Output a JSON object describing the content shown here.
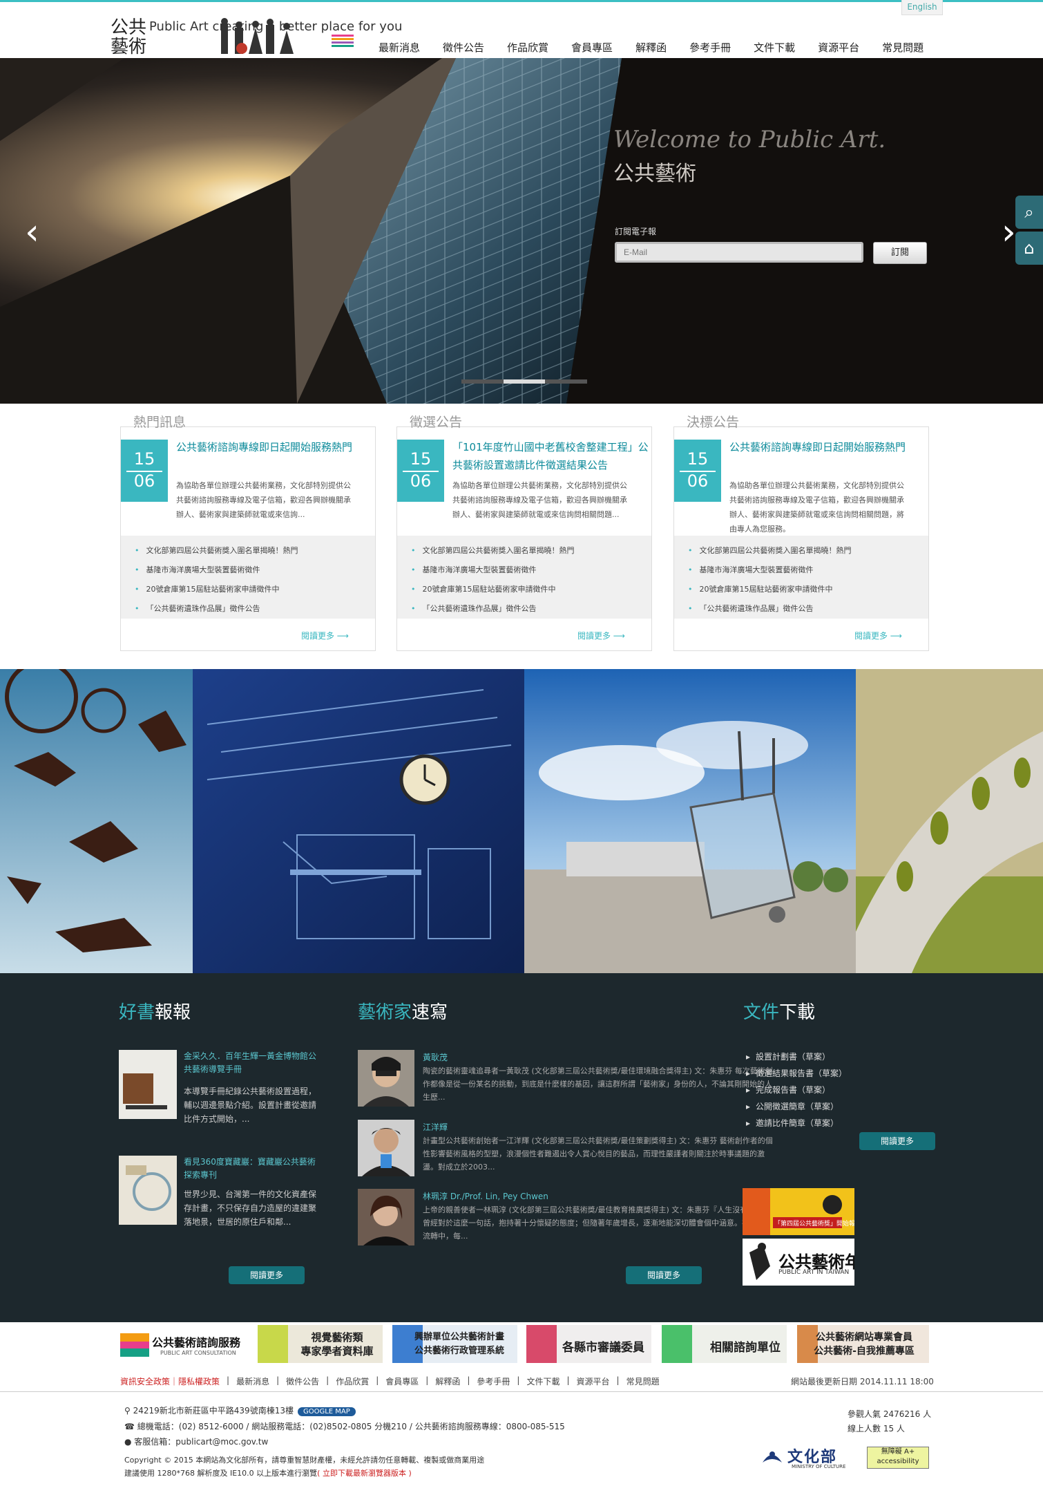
{
  "header": {
    "english": "English",
    "logo_cjk": "公共藝術",
    "logo_en": "Public Art creating a better place for you",
    "nav": [
      "最新消息",
      "徵件公告",
      "作品欣賞",
      "會員專區",
      "解釋函",
      "參考手冊",
      "文件下載",
      "資源平台",
      "常見問題"
    ]
  },
  "hero": {
    "welcome": "Welcome to Public Art.",
    "subtitle": "公共藝術",
    "subscribe_label": "訂閱電子報",
    "email_placeholder": "E-Mail",
    "subscribe_button": "訂閱"
  },
  "cards": [
    {
      "title": "熱門訊息",
      "date_day": "15",
      "date_month": "06",
      "headline": "公共藝術諮詢專線即日起開始服務熱門",
      "body": "為協助各單位辦理公共藝術業務，文化部特別提供公共藝術諮詢服務專線及電子信箱，歡迎各興辦機關承辦人、藝術家與建築師就電或來信詢...",
      "items": [
        "文化部第四屆公共藝術獎入圍名單揭曉！熱門",
        "基隆市海洋廣場大型裝置藝術徵件",
        "20號倉庫第15屆駐站藝術家申請徵件中",
        "「公共藝術遺珠作品展」徵件公告"
      ],
      "more": "閱讀更多 ⟶"
    },
    {
      "title": "徵選公告",
      "date_day": "15",
      "date_month": "06",
      "headline": "「101年度竹山國中老舊校舍整建工程」公共藝術設置邀請比件徵選結果公告",
      "body": "為協助各單位辦理公共藝術業務，文化部特別提供公共藝術諮詢服務專線及電子信箱，歡迎各興辦機關承辦人、藝術家與建築師就電或來信詢問相關問題...",
      "items": [
        "文化部第四屆公共藝術獎入圍名單揭曉！熱門",
        "基隆市海洋廣場大型裝置藝術徵件",
        "20號倉庫第15屆駐站藝術家申請徵件中",
        "「公共藝術遺珠作品展」徵件公告"
      ],
      "more": "閱讀更多 ⟶"
    },
    {
      "title": "決標公告",
      "date_day": "15",
      "date_month": "06",
      "headline": "公共藝術諮詢專線即日起開始服務熱門",
      "body": "為協助各單位辦理公共藝術業務，文化部特別提供公共藝術諮詢服務專線及電子信箱，歡迎各興辦機關承辦人、藝術家與建築師就電或來信詢問相關問題，將由專人為您服務。",
      "items": [
        "文化部第四屆公共藝術獎入圍名單揭曉！熱門",
        "基隆市海洋廣場大型裝置藝術徵件",
        "20號倉庫第15屆駐站藝術家申請徵件中",
        "「公共藝術遺珠作品展」徵件公告"
      ],
      "more": "閱讀更多 ⟶"
    }
  ],
  "books": {
    "title_a": "好書",
    "title_b": "報報",
    "items": [
      {
        "title": "金采久久．百年生輝一黃金博物館公共藝術導覽手冊",
        "body": "本導覽手冊紀錄公共藝術設置過程，輔以週邊景點介紹。設置計畫從邀請比件方式開始，..."
      },
      {
        "title": "看見360度寶藏巖：寶藏巖公共藝術探索專刊",
        "body": "世界少見、台灣第一件的文化資產保存計畫，不只保存自力造屋的違建聚落地景，世居的原住戶和鄰..."
      }
    ],
    "more": "閱讀更多"
  },
  "artists": {
    "title_a": "藝術家",
    "title_b": "速寫",
    "items": [
      {
        "name": "黃耿茂",
        "body": "陶瓷的藝術靈魂追尋者一黃耿茂 (文化部第三屆公共藝術獎/最佳環境融合獎得主) 文：朱惠芬 每次藝術創作都像是從一份某名的挑動，到底是什麼樣的基因，讓這群所謂「藝術家」身份的人，不論其剛開始的人生歷..."
      },
      {
        "name": "江洋輝",
        "body": "計畫型公共藝術創始者一江洋輝 (文化部第三屆公共藝術獎/最佳策劃獎得主) 文：朱惠芬 藝術創作者的個性影響藝術風格的型塑，浪漫個性者難遏出令人賞心悅目的藝品，而理性嚴謹者則關注於時事議題的激盪。對成立於2003..."
      },
      {
        "name": "林珮淳 Dr./Prof. Lin, Pey Chwen",
        "body": "上帝的親善使者一林珮淳 (文化部第三屆公共藝術獎/最佳教育推廣獎得主) 文：朱惠芬『人生沒有 偶然！』曾經對於這麼一句話，抱持著十分懷疑的態度；但隨著年歲增長，逐漸地能深切體會個中涵意。在生命的流轉中，每..."
      }
    ],
    "more": "閱讀更多"
  },
  "downloads": {
    "title_a": "文件",
    "title_b": "下載",
    "items": [
      "設置計劃書（草案）",
      "徵選結果報告書（草案）",
      "完成報告書（草案）",
      "公開徵選簡章（草案）",
      "邀請比件簡章（草案）"
    ],
    "more": "閱讀更多",
    "banner1_text": "「第四屆公共藝術獎」開始報名",
    "banner2_title": "公共藝術年鑑",
    "banner2_sub": "PUBLIC ART IN TAIWAN"
  },
  "links": [
    {
      "main": "公共藝術諮詢服務",
      "sub": "PUBLIC ART CONSULTATION"
    },
    {
      "main": "視覺藝術類\n專家學者資料庫",
      "sub": ""
    },
    {
      "main": "興辦單位公共藝術計畫\n公共藝術行政管理系統",
      "sub": ""
    },
    {
      "main": "各縣市審議委員",
      "sub": ""
    },
    {
      "main": "相關諮詢單位",
      "sub": ""
    },
    {
      "main": "公共藝術網站專業會員\n公共藝術-自我推薦專區",
      "sub": ""
    }
  ],
  "footer": {
    "nav_red": "資訊安全政策｜隱私權政策",
    "nav": [
      "最新消息",
      "徵件公告",
      "作品欣賞",
      "會員專區",
      "解釋函",
      "參考手冊",
      "文件下載",
      "資源平台",
      "常見問題"
    ],
    "last_update": "網站最後更新日期 2014.11.11 18:00",
    "address": "24219新北市新莊區中平路439號南棟13樓",
    "google_map": "GOOGLE MAP",
    "phone": "總機電話：(02) 8512-6000 / 網站服務電話：(02)8502-0805 分機210 / 公共藝術諮詢服務專線：0800-085-515",
    "email": "客服信箱：publicart@moc.gov.tw",
    "copyright": "Copyright © 2015 本網站為文化部所有，請尊重智慧財產權，未經允許請勿任意轉載、複製或做商業用途",
    "browser": "建議使用 1280*768 解析度及 IE10.0 以上版本進行瀏覽",
    "browser_link": "( 立即下載最新瀏覽器版本 )",
    "visitors": "參觀人氣  2476216 人",
    "online": "線上人數 15 人",
    "moc": "文化部",
    "moc_en": "MINISTRY OF CULTURE",
    "accessibility": "無障礙 A+ accessibility"
  }
}
